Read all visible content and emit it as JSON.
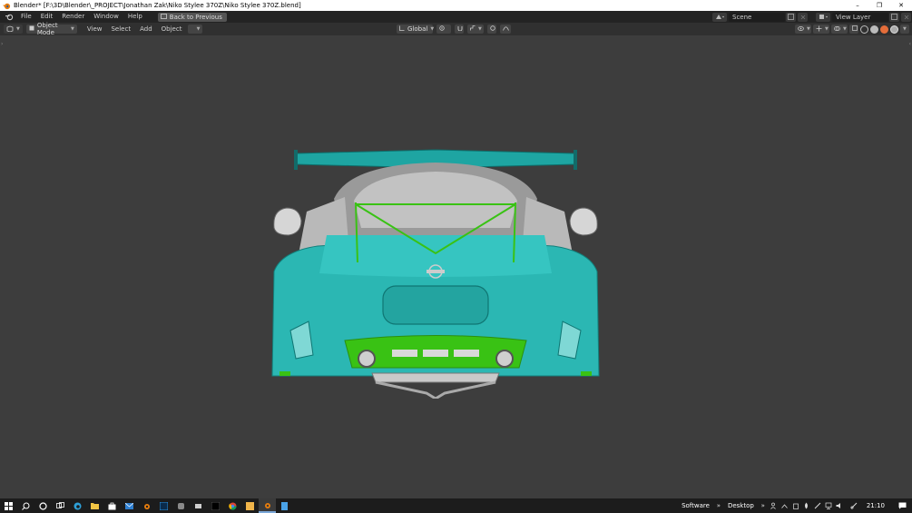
{
  "window": {
    "title": "Blender* [F:\\3D\\Blender\\_PROJECT\\Jonathan Zak\\Niko Stylee 370Z\\Niko Stylee 370Z.blend]",
    "minimize": "–",
    "restore": "❐",
    "close": "✕"
  },
  "topbar": {
    "menus": [
      "File",
      "Edit",
      "Render",
      "Window",
      "Help"
    ],
    "back_label": "Back to Previous",
    "scene_label": "Scene",
    "view_layer_label": "View Layer"
  },
  "header": {
    "mode_label": "Object Mode",
    "menus": [
      "View",
      "Select",
      "Add",
      "Object"
    ],
    "orientation_label": "Global"
  },
  "taskbar": {
    "toolbar_software": "Software",
    "toolbar_desktop": "Desktop",
    "clock": "21:10",
    "chevron": "»"
  },
  "colors": {
    "body_teal": "#2bb7b3",
    "selected_green": "#39c214",
    "accent_blue": "#7aa7d8"
  }
}
